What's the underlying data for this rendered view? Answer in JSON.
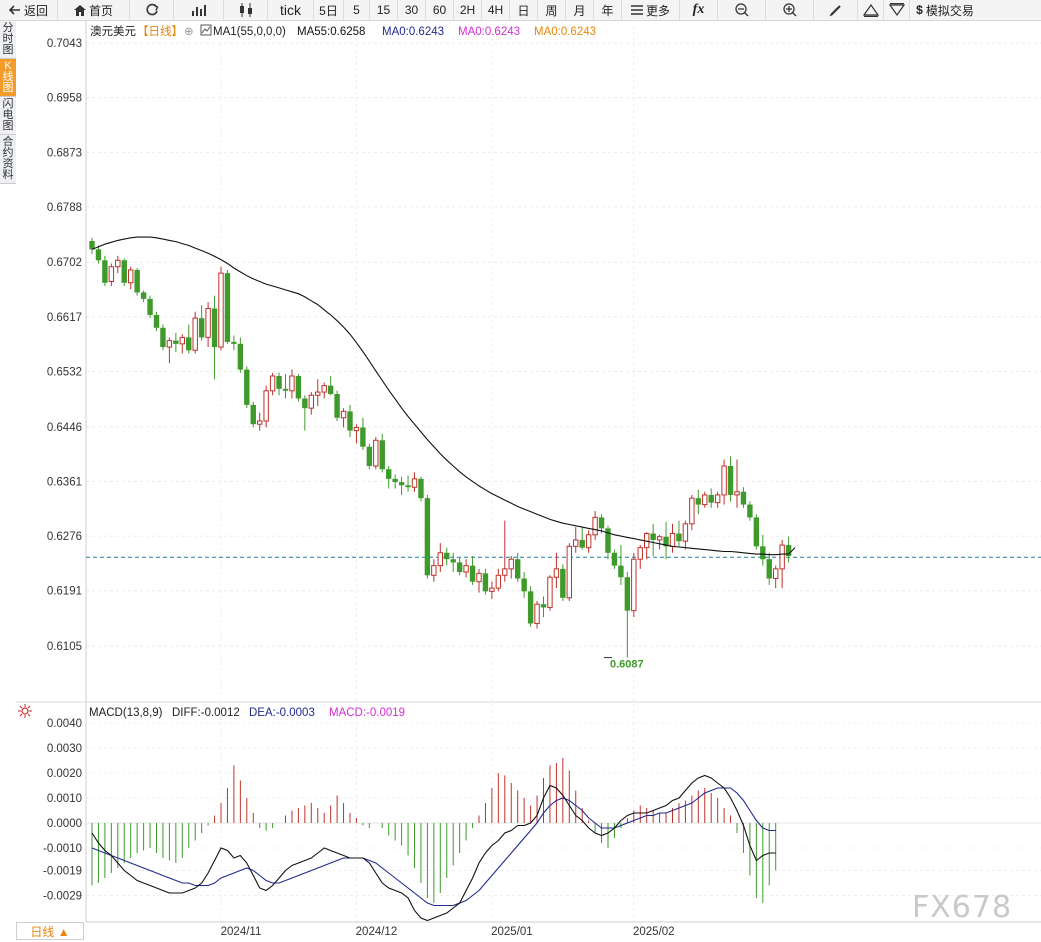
{
  "toolbar": {
    "back": "返回",
    "home": "首页",
    "tick": "tick",
    "periods": [
      "5日",
      "5",
      "15",
      "30",
      "60",
      "2H",
      "4H",
      "日",
      "周",
      "月",
      "年"
    ],
    "more": "更多",
    "fx": "fx",
    "sim": "模拟交易"
  },
  "side_tabs": [
    "分时图",
    "K线图",
    "闪电图",
    "合约资料"
  ],
  "active_side_tab": 1,
  "bottom_tab": "日线 ▲",
  "watermark": "FX678",
  "colors": {
    "up": "#c0312b",
    "down": "#3f9a2c",
    "ma55": "#111111",
    "dif": "#111111",
    "dea": "#1f2a8f",
    "macd_label": "#d62cd6",
    "ref_line": "#1b7f99",
    "dea_label": "#1f2a8f",
    "ma_orange": "#e8860c",
    "low_label": "#3f9a2c"
  },
  "chart_data": [
    {
      "type": "candlestick",
      "title": "澳元美元",
      "period_badge": "【日线】",
      "legend": {
        "ma_header": "MA1(55,0,0,0)",
        "ma55": "MA55:0.6258",
        "ma0a": "MA0:0.6243",
        "ma0b": "MA0:0.6243",
        "ma0c": "MA0:0.6243"
      },
      "y_ticks": [
        "0.7043",
        "0.6958",
        "0.6873",
        "0.6788",
        "0.6702",
        "0.6617",
        "0.6532",
        "0.6446",
        "0.6361",
        "0.6276",
        "0.6191",
        "0.6105"
      ],
      "x_ticks": [
        {
          "label": "2024/11",
          "index": 20
        },
        {
          "label": "2024/12",
          "index": 41
        },
        {
          "label": "2025/01",
          "index": 62
        },
        {
          "label": "2025/02",
          "index": 84
        }
      ],
      "reference_line": 0.6243,
      "low_annotation": {
        "label": "0.6087",
        "index": 80,
        "value": 0.6087
      },
      "ohlc": [
        [
          0.6735,
          0.674,
          0.6715,
          0.6722
        ],
        [
          0.6722,
          0.6728,
          0.67,
          0.6705
        ],
        [
          0.6705,
          0.6712,
          0.6665,
          0.667
        ],
        [
          0.6672,
          0.67,
          0.6665,
          0.6695
        ],
        [
          0.6695,
          0.6712,
          0.6685,
          0.6705
        ],
        [
          0.6705,
          0.6708,
          0.6665,
          0.667
        ],
        [
          0.667,
          0.6695,
          0.666,
          0.669
        ],
        [
          0.669,
          0.6693,
          0.665,
          0.6655
        ],
        [
          0.6655,
          0.6658,
          0.664,
          0.6645
        ],
        [
          0.6645,
          0.665,
          0.6615,
          0.662
        ],
        [
          0.662,
          0.6625,
          0.6595,
          0.66
        ],
        [
          0.66,
          0.6605,
          0.6565,
          0.657
        ],
        [
          0.657,
          0.6585,
          0.6545,
          0.658
        ],
        [
          0.658,
          0.6592,
          0.6562,
          0.6575
        ],
        [
          0.6575,
          0.659,
          0.656,
          0.6585
        ],
        [
          0.6585,
          0.6605,
          0.656,
          0.6565
        ],
        [
          0.6565,
          0.6625,
          0.656,
          0.6615
        ],
        [
          0.6615,
          0.6635,
          0.658,
          0.6585
        ],
        [
          0.6585,
          0.664,
          0.657,
          0.663
        ],
        [
          0.663,
          0.665,
          0.652,
          0.657
        ],
        [
          0.657,
          0.6695,
          0.6565,
          0.6685
        ],
        [
          0.6685,
          0.669,
          0.6575,
          0.6578
        ],
        [
          0.6578,
          0.6588,
          0.6565,
          0.6575
        ],
        [
          0.6575,
          0.6585,
          0.653,
          0.6535
        ],
        [
          0.6535,
          0.654,
          0.6475,
          0.648
        ],
        [
          0.648,
          0.6485,
          0.6445,
          0.645
        ],
        [
          0.645,
          0.6468,
          0.644,
          0.6455
        ],
        [
          0.6455,
          0.651,
          0.6445,
          0.6502
        ],
        [
          0.6502,
          0.653,
          0.6495,
          0.6525
        ],
        [
          0.6525,
          0.653,
          0.6495,
          0.6505
        ],
        [
          0.6505,
          0.6528,
          0.649,
          0.6502
        ],
        [
          0.6502,
          0.6535,
          0.649,
          0.6525
        ],
        [
          0.6525,
          0.6528,
          0.6485,
          0.649
        ],
        [
          0.649,
          0.6495,
          0.644,
          0.6475
        ],
        [
          0.6475,
          0.65,
          0.6465,
          0.6495
        ],
        [
          0.6495,
          0.652,
          0.6478,
          0.65
        ],
        [
          0.65,
          0.6515,
          0.649,
          0.651
        ],
        [
          0.651,
          0.6525,
          0.6495,
          0.6497
        ],
        [
          0.6497,
          0.6502,
          0.6455,
          0.646
        ],
        [
          0.646,
          0.6475,
          0.6445,
          0.647
        ],
        [
          0.647,
          0.648,
          0.643,
          0.644
        ],
        [
          0.644,
          0.645,
          0.642,
          0.6445
        ],
        [
          0.6445,
          0.646,
          0.641,
          0.6415
        ],
        [
          0.6415,
          0.642,
          0.638,
          0.6385
        ],
        [
          0.6385,
          0.643,
          0.638,
          0.6425
        ],
        [
          0.6425,
          0.6435,
          0.6375,
          0.638
        ],
        [
          0.638,
          0.6385,
          0.635,
          0.6365
        ],
        [
          0.6365,
          0.6372,
          0.635,
          0.636
        ],
        [
          0.636,
          0.6368,
          0.634,
          0.6355
        ],
        [
          0.6355,
          0.637,
          0.6345,
          0.6352
        ],
        [
          0.6352,
          0.6375,
          0.6345,
          0.6365
        ],
        [
          0.6365,
          0.6368,
          0.633,
          0.6335
        ],
        [
          0.6335,
          0.634,
          0.621,
          0.6215
        ],
        [
          0.6215,
          0.624,
          0.6205,
          0.623
        ],
        [
          0.623,
          0.6265,
          0.622,
          0.625
        ],
        [
          0.625,
          0.6258,
          0.623,
          0.624
        ],
        [
          0.624,
          0.625,
          0.622,
          0.6235
        ],
        [
          0.6235,
          0.6242,
          0.6215,
          0.622
        ],
        [
          0.622,
          0.624,
          0.6212,
          0.623
        ],
        [
          0.623,
          0.6245,
          0.62,
          0.6205
        ],
        [
          0.6205,
          0.6225,
          0.6188,
          0.6218
        ],
        [
          0.6218,
          0.6225,
          0.6185,
          0.619
        ],
        [
          0.619,
          0.6205,
          0.6178,
          0.6195
        ],
        [
          0.6195,
          0.6225,
          0.619,
          0.6215
        ],
        [
          0.6215,
          0.63,
          0.6205,
          0.6225
        ],
        [
          0.6225,
          0.6245,
          0.621,
          0.624
        ],
        [
          0.624,
          0.625,
          0.6205,
          0.621
        ],
        [
          0.621,
          0.622,
          0.618,
          0.619
        ],
        [
          0.619,
          0.6198,
          0.6135,
          0.614
        ],
        [
          0.614,
          0.6175,
          0.6132,
          0.617
        ],
        [
          0.617,
          0.6182,
          0.615,
          0.6165
        ],
        [
          0.6165,
          0.6215,
          0.616,
          0.6212
        ],
        [
          0.6212,
          0.625,
          0.6195,
          0.6225
        ],
        [
          0.6225,
          0.6232,
          0.6175,
          0.618
        ],
        [
          0.618,
          0.6265,
          0.6175,
          0.626
        ],
        [
          0.626,
          0.629,
          0.625,
          0.627
        ],
        [
          0.627,
          0.629,
          0.6255,
          0.6258
        ],
        [
          0.6258,
          0.6285,
          0.625,
          0.6278
        ],
        [
          0.6278,
          0.6315,
          0.627,
          0.6305
        ],
        [
          0.6305,
          0.631,
          0.628,
          0.6288
        ],
        [
          0.6288,
          0.6292,
          0.624,
          0.625
        ],
        [
          0.625,
          0.6255,
          0.6225,
          0.623
        ],
        [
          0.623,
          0.6262,
          0.62,
          0.6212
        ],
        [
          0.6212,
          0.622,
          0.6087,
          0.616
        ],
        [
          0.616,
          0.625,
          0.615,
          0.624
        ],
        [
          0.624,
          0.6262,
          0.6225,
          0.6258
        ],
        [
          0.6258,
          0.6282,
          0.624,
          0.628
        ],
        [
          0.628,
          0.6295,
          0.6245,
          0.627
        ],
        [
          0.627,
          0.6278,
          0.6255,
          0.6275
        ],
        [
          0.6275,
          0.6298,
          0.624,
          0.626
        ],
        [
          0.626,
          0.6295,
          0.625,
          0.628
        ],
        [
          0.628,
          0.63,
          0.626,
          0.6268
        ],
        [
          0.6268,
          0.63,
          0.6255,
          0.6295
        ],
        [
          0.6295,
          0.634,
          0.6285,
          0.6335
        ],
        [
          0.6335,
          0.6348,
          0.631,
          0.6325
        ],
        [
          0.6325,
          0.6345,
          0.632,
          0.634
        ],
        [
          0.634,
          0.635,
          0.632,
          0.6328
        ],
        [
          0.6328,
          0.6345,
          0.632,
          0.634
        ],
        [
          0.634,
          0.6395,
          0.6325,
          0.6385
        ],
        [
          0.6385,
          0.64,
          0.633,
          0.634
        ],
        [
          0.634,
          0.6395,
          0.632,
          0.6345
        ],
        [
          0.6345,
          0.6352,
          0.632,
          0.6325
        ],
        [
          0.6325,
          0.633,
          0.63,
          0.6305
        ],
        [
          0.6305,
          0.631,
          0.6255,
          0.626
        ],
        [
          0.626,
          0.6278,
          0.623,
          0.624
        ],
        [
          0.624,
          0.625,
          0.62,
          0.621
        ],
        [
          0.621,
          0.623,
          0.6195,
          0.6225
        ],
        [
          0.6225,
          0.627,
          0.6195,
          0.6262
        ],
        [
          0.6262,
          0.6275,
          0.6235,
          0.6245
        ]
      ],
      "ma55": [
        0.6722,
        0.6726,
        0.673,
        0.6733,
        0.6736,
        0.6738,
        0.674,
        0.6741,
        0.6741,
        0.6741,
        0.674,
        0.6738,
        0.6736,
        0.6734,
        0.6731,
        0.6728,
        0.6724,
        0.672,
        0.6716,
        0.6711,
        0.6706,
        0.67,
        0.6693,
        0.6687,
        0.6681,
        0.6676,
        0.6672,
        0.6668,
        0.6665,
        0.6662,
        0.6659,
        0.6656,
        0.6653,
        0.6648,
        0.6642,
        0.6636,
        0.6628,
        0.662,
        0.6611,
        0.6601,
        0.659,
        0.6577,
        0.6563,
        0.6548,
        0.6533,
        0.6518,
        0.6503,
        0.6489,
        0.6475,
        0.6462,
        0.645,
        0.6438,
        0.6426,
        0.6415,
        0.6404,
        0.6394,
        0.6385,
        0.6376,
        0.6368,
        0.6361,
        0.6354,
        0.6348,
        0.6342,
        0.6337,
        0.6332,
        0.6327,
        0.6322,
        0.6318,
        0.6314,
        0.631,
        0.6306,
        0.6302,
        0.6299,
        0.6296,
        0.6294,
        0.6292,
        0.629,
        0.6288,
        0.6286,
        0.6284,
        0.6281,
        0.6278,
        0.6276,
        0.6274,
        0.6272,
        0.627,
        0.6268,
        0.6266,
        0.6264,
        0.6262,
        0.626,
        0.6259,
        0.6258,
        0.6257,
        0.6256,
        0.6255,
        0.6254,
        0.6253,
        0.6252,
        0.6252,
        0.6251,
        0.625,
        0.6249,
        0.6248,
        0.6248,
        0.6247,
        0.6247,
        0.6248,
        0.6248,
        0.6258
      ]
    },
    {
      "type": "macd",
      "legend": {
        "name": "MACD(13,8,9)",
        "diff": "DIFF:-0.0012",
        "dea": "DEA:-0.0003",
        "macd": "MACD:-0.0019"
      },
      "y_ticks": [
        "0.0040",
        "0.0030",
        "0.0020",
        "0.0010",
        "0.0000",
        "-0.0010",
        "-0.0019",
        "-0.0029"
      ],
      "histogram": [
        -0.0025,
        -0.0024,
        -0.0022,
        -0.002,
        -0.0018,
        -0.0016,
        -0.0014,
        -0.0012,
        -0.0011,
        -0.001,
        -0.0012,
        -0.0014,
        -0.0015,
        -0.0016,
        -0.0014,
        -0.001,
        -0.0007,
        -0.0004,
        -0.0001,
        0.0003,
        0.0008,
        0.0014,
        0.0023,
        0.0017,
        0.001,
        0.0004,
        -0.0002,
        -0.0003,
        -0.0002,
        0.0,
        0.0003,
        0.0005,
        0.0006,
        0.0007,
        0.0008,
        0.0006,
        0.0004,
        0.0007,
        0.0011,
        0.0008,
        0.0004,
        0.0002,
        -0.0001,
        -0.0002,
        0.0,
        -0.0002,
        -0.0005,
        -0.0007,
        -0.0009,
        -0.0013,
        -0.0018,
        -0.0024,
        -0.003,
        -0.0032,
        -0.0028,
        -0.0022,
        -0.0017,
        -0.0012,
        -0.0007,
        -0.0002,
        0.0003,
        0.0008,
        0.0014,
        0.002,
        0.0019,
        0.0016,
        0.0013,
        0.001,
        0.0007,
        0.0011,
        0.0018,
        0.0023,
        0.0024,
        0.0026,
        0.0021,
        0.0013,
        0.0006,
        0.0001,
        -0.0004,
        -0.0008,
        -0.001,
        -0.0006,
        -0.0002,
        0.0002,
        0.0005,
        0.0007,
        0.0006,
        0.0005,
        0.0004,
        0.0004,
        0.0006,
        0.0008,
        0.0009,
        0.0011,
        0.0013,
        0.0014,
        0.0012,
        0.001,
        0.0006,
        0.0003,
        -0.0004,
        -0.0012,
        -0.0021,
        -0.003,
        -0.0032,
        -0.0025,
        -0.0019
      ],
      "diff": [
        -0.0004,
        -0.0008,
        -0.0011,
        -0.0013,
        -0.0016,
        -0.0019,
        -0.0021,
        -0.0023,
        -0.0024,
        -0.0025,
        -0.0026,
        -0.0027,
        -0.0028,
        -0.0028,
        -0.0028,
        -0.0027,
        -0.0026,
        -0.0024,
        -0.002,
        -0.0015,
        -0.001,
        -0.0011,
        -0.0014,
        -0.0013,
        -0.0016,
        -0.0021,
        -0.0026,
        -0.0027,
        -0.0025,
        -0.0022,
        -0.0019,
        -0.0017,
        -0.0016,
        -0.0015,
        -0.0014,
        -0.0012,
        -0.001,
        -0.0011,
        -0.0012,
        -0.0013,
        -0.0014,
        -0.0014,
        -0.0014,
        -0.0016,
        -0.002,
        -0.0024,
        -0.0026,
        -0.0027,
        -0.0028,
        -0.003,
        -0.0035,
        -0.0038,
        -0.0039,
        -0.0038,
        -0.0037,
        -0.0036,
        -0.0034,
        -0.0032,
        -0.0027,
        -0.0022,
        -0.0016,
        -0.0012,
        -0.0009,
        -0.0007,
        -0.0004,
        -0.0003,
        -0.0001,
        -0.0001,
        0.0,
        0.0003,
        0.001,
        0.0015,
        0.0014,
        0.0011,
        0.0007,
        0.0003,
        0.0001,
        -0.0002,
        -0.0004,
        -0.0005,
        -0.0004,
        -0.0002,
        0.0001,
        0.0003,
        0.0004,
        0.0004,
        0.0004,
        0.0005,
        0.0006,
        0.0007,
        0.0009,
        0.001,
        0.0013,
        0.0016,
        0.0018,
        0.0019,
        0.0018,
        0.0016,
        0.0014,
        0.001,
        0.0005,
        -0.0001,
        -0.0009,
        -0.0015,
        -0.0013,
        -0.0012,
        -0.0012
      ],
      "dea": [
        -0.001,
        -0.0011,
        -0.0012,
        -0.0013,
        -0.0014,
        -0.0015,
        -0.0016,
        -0.0017,
        -0.0018,
        -0.0019,
        -0.002,
        -0.0021,
        -0.0022,
        -0.0023,
        -0.0024,
        -0.0024,
        -0.0025,
        -0.0025,
        -0.0025,
        -0.0024,
        -0.0022,
        -0.0021,
        -0.002,
        -0.0019,
        -0.0018,
        -0.0019,
        -0.0021,
        -0.0023,
        -0.0024,
        -0.0024,
        -0.0023,
        -0.0022,
        -0.0021,
        -0.002,
        -0.0019,
        -0.0018,
        -0.0017,
        -0.0016,
        -0.0015,
        -0.0014,
        -0.0014,
        -0.0014,
        -0.0014,
        -0.0015,
        -0.0016,
        -0.0018,
        -0.002,
        -0.0022,
        -0.0024,
        -0.0026,
        -0.0028,
        -0.003,
        -0.0032,
        -0.0033,
        -0.0033,
        -0.0033,
        -0.0033,
        -0.0032,
        -0.0031,
        -0.0029,
        -0.0027,
        -0.0024,
        -0.0021,
        -0.0018,
        -0.0015,
        -0.0012,
        -0.0009,
        -0.0006,
        -0.0003,
        0.0,
        0.0004,
        0.0007,
        0.0009,
        0.001,
        0.0009,
        0.0007,
        0.0005,
        0.0002,
        0.0,
        -0.0002,
        -0.0002,
        -0.0002,
        -0.0001,
        0.0,
        0.0001,
        0.0002,
        0.0003,
        0.0003,
        0.0004,
        0.0004,
        0.0005,
        0.0006,
        0.0007,
        0.0008,
        0.001,
        0.0012,
        0.0013,
        0.0014,
        0.0014,
        0.0014,
        0.0012,
        0.0009,
        0.0005,
        0.0001,
        -0.0002,
        -0.0003,
        -0.0003
      ]
    }
  ]
}
